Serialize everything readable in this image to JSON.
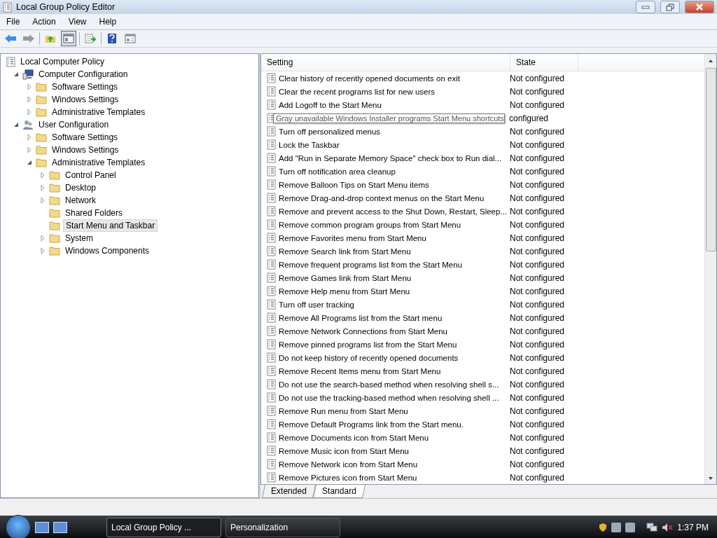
{
  "window": {
    "title": "Local Group Policy Editor"
  },
  "menu": [
    "File",
    "Action",
    "View",
    "Help"
  ],
  "tree": [
    {
      "label": "Local Computer Policy",
      "kind": "policy",
      "selected": false,
      "children": [
        {
          "label": "Computer Configuration",
          "kind": "computer",
          "expanded": true,
          "selected": false,
          "children": [
            {
              "label": "Software Settings",
              "kind": "folder",
              "expanded": false,
              "selected": false
            },
            {
              "label": "Windows Settings",
              "kind": "folder",
              "expanded": false,
              "selected": false
            },
            {
              "label": "Administrative Templates",
              "kind": "folder",
              "expanded": false,
              "selected": false
            }
          ]
        },
        {
          "label": "User Configuration",
          "kind": "user",
          "expanded": true,
          "selected": false,
          "children": [
            {
              "label": "Software Settings",
              "kind": "folder",
              "expanded": false,
              "selected": false
            },
            {
              "label": "Windows Settings",
              "kind": "folder",
              "expanded": false,
              "selected": false
            },
            {
              "label": "Administrative Templates",
              "kind": "folder",
              "expanded": true,
              "selected": false,
              "children": [
                {
                  "label": "Control Panel",
                  "kind": "folder",
                  "expanded": false,
                  "selected": false
                },
                {
                  "label": "Desktop",
                  "kind": "folder",
                  "expanded": false,
                  "selected": false
                },
                {
                  "label": "Network",
                  "kind": "folder",
                  "expanded": false,
                  "selected": false
                },
                {
                  "label": "Shared Folders",
                  "kind": "folder",
                  "selected": false
                },
                {
                  "label": "Start Menu and Taskbar",
                  "kind": "folder",
                  "selected": true
                },
                {
                  "label": "System",
                  "kind": "folder",
                  "expanded": false,
                  "selected": false
                },
                {
                  "label": "Windows Components",
                  "kind": "folder",
                  "expanded": false,
                  "selected": false
                }
              ]
            }
          ]
        }
      ]
    }
  ],
  "table": {
    "columns": [
      "Setting",
      "State"
    ],
    "rows": [
      {
        "setting": "Clear history of recently opened documents on exit",
        "state": "Not configured"
      },
      {
        "setting": "Clear the recent programs list for new users",
        "state": "Not configured"
      },
      {
        "setting": "Add Logoff to the Start Menu",
        "state": "Not configured"
      },
      {
        "tooltip": "Gray unavailable Windows Installer programs Start Menu shortcuts",
        "state": "configured"
      },
      {
        "setting": "Turn off personalized menus",
        "state": "Not configured"
      },
      {
        "setting": "Lock the Taskbar",
        "state": "Not configured"
      },
      {
        "setting": "Add \"Run in Separate Memory Space\" check box to Run dial...",
        "state": "Not configured"
      },
      {
        "setting": "Turn off notification area cleanup",
        "state": "Not configured"
      },
      {
        "setting": "Remove Balloon Tips on Start Menu items",
        "state": "Not configured"
      },
      {
        "setting": "Remove Drag-and-drop context menus on the Start Menu",
        "state": "Not configured"
      },
      {
        "setting": "Remove and prevent access to the Shut Down, Restart, Sleep...",
        "state": "Not configured"
      },
      {
        "setting": "Remove common program groups from Start Menu",
        "state": "Not configured"
      },
      {
        "setting": "Remove Favorites menu from Start Menu",
        "state": "Not configured"
      },
      {
        "setting": "Remove Search link from Start Menu",
        "state": "Not configured"
      },
      {
        "setting": "Remove frequent programs list from the Start Menu",
        "state": "Not configured"
      },
      {
        "setting": "Remove Games link from Start Menu",
        "state": "Not configured"
      },
      {
        "setting": "Remove Help menu from Start Menu",
        "state": "Not configured"
      },
      {
        "setting": "Turn off user tracking",
        "state": "Not configured"
      },
      {
        "setting": "Remove All Programs list from the Start menu",
        "state": "Not configured"
      },
      {
        "setting": "Remove Network Connections from Start Menu",
        "state": "Not configured"
      },
      {
        "setting": "Remove pinned programs list from the Start Menu",
        "state": "Not configured"
      },
      {
        "setting": "Do not keep history of recently opened documents",
        "state": "Not configured"
      },
      {
        "setting": "Remove Recent Items menu from Start Menu",
        "state": "Not configured"
      },
      {
        "setting": "Do not use the search-based method when resolving shell s...",
        "state": "Not configured"
      },
      {
        "setting": "Do not use the tracking-based method when resolving shell ...",
        "state": "Not configured"
      },
      {
        "setting": "Remove Run menu from Start Menu",
        "state": "Not configured"
      },
      {
        "setting": "Remove Default Programs link from the Start menu.",
        "state": "Not configured"
      },
      {
        "setting": "Remove Documents icon from Start Menu",
        "state": "Not configured"
      },
      {
        "setting": "Remove Music icon from Start Menu",
        "state": "Not configured"
      },
      {
        "setting": "Remove Network icon from Start Menu",
        "state": "Not configured"
      },
      {
        "setting": "Remove Pictures icon from Start Menu",
        "state": "Not configured"
      }
    ]
  },
  "tabs": [
    {
      "label": "Extended",
      "selected": false
    },
    {
      "label": "Standard",
      "selected": true
    }
  ],
  "taskbar": {
    "tasks": [
      {
        "label": "Local Group Policy ...",
        "selected": true
      },
      {
        "label": "Personalization",
        "selected": false
      }
    ],
    "clock": "1:37 PM"
  }
}
